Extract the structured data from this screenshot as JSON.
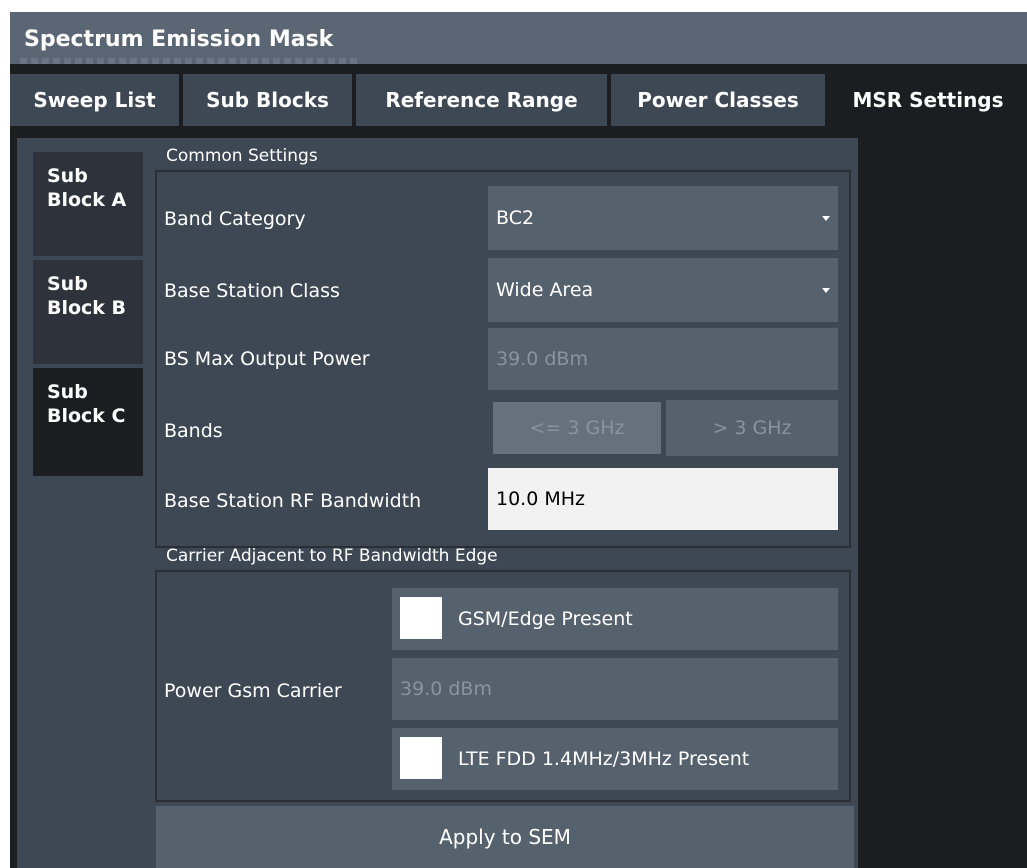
{
  "window": {
    "title": "Spectrum Emission Mask"
  },
  "tabs": [
    {
      "label": "Sweep List"
    },
    {
      "label": "Sub Blocks"
    },
    {
      "label": "Reference Range"
    },
    {
      "label": "Power Classes"
    },
    {
      "label": "MSR Settings",
      "active": true
    }
  ],
  "side_tabs": [
    {
      "line1": "Sub",
      "line2": "Block A"
    },
    {
      "line1": "Sub",
      "line2": "Block B"
    },
    {
      "line1": "Sub",
      "line2": "Block C",
      "active": true
    }
  ],
  "common": {
    "group_label": "Common Settings",
    "band_category": {
      "label": "Band Category",
      "value": "BC2"
    },
    "bs_class": {
      "label": "Base Station Class",
      "value": "Wide Area"
    },
    "max_power": {
      "label": "BS Max Output Power",
      "value": "39.0 dBm"
    },
    "bands": {
      "label": "Bands",
      "options": [
        "<= 3 GHz",
        "> 3 GHz"
      ]
    },
    "rf_bandwidth": {
      "label": "Base Station RF Bandwidth",
      "value": "10.0 MHz"
    }
  },
  "carrier": {
    "group_label": "Carrier Adjacent to RF Bandwidth Edge",
    "gsm_present": {
      "label": "GSM/Edge Present",
      "checked": false
    },
    "power_gsm": {
      "label": "Power Gsm Carrier",
      "value": "39.0 dBm"
    },
    "lte_present": {
      "label": "LTE FDD 1.4MHz/3MHz Present",
      "checked": false
    }
  },
  "apply_label": "Apply to SEM",
  "colors": {
    "background": "#1b1d21",
    "panel": "#3e4754",
    "field": "#56616e",
    "title_bar": "#5b6674"
  }
}
